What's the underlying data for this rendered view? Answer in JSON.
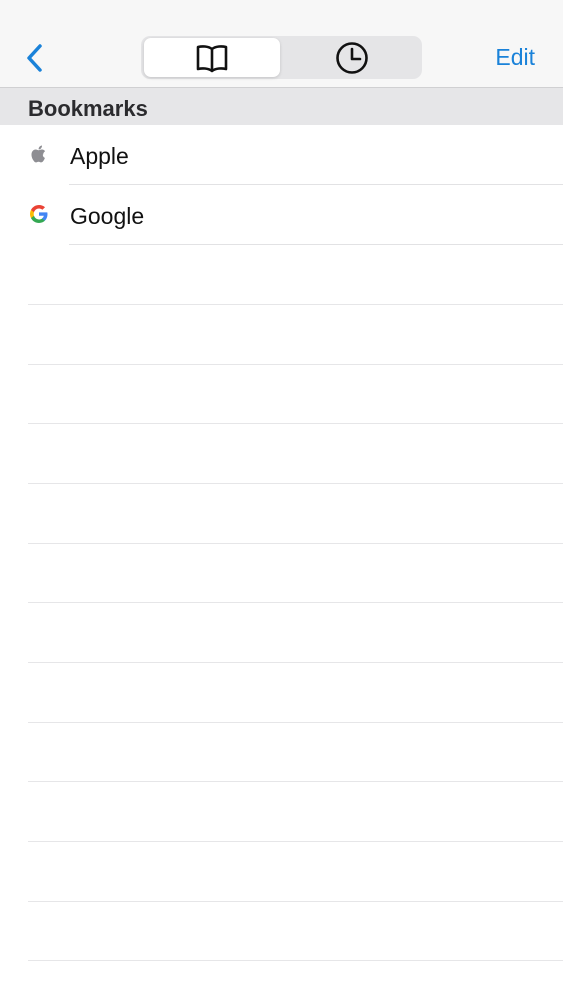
{
  "navbar": {
    "back_icon": "chevron-left-icon",
    "segments": [
      {
        "icon": "book-icon",
        "selected": true
      },
      {
        "icon": "clock-icon",
        "selected": false
      }
    ],
    "edit_label": "Edit"
  },
  "section": {
    "title": "Bookmarks"
  },
  "bookmarks": [
    {
      "label": "Apple",
      "icon": "apple-icon"
    },
    {
      "label": "Google",
      "icon": "google-icon"
    }
  ],
  "colors": {
    "accent": "#1a82d9",
    "navbar_bg": "#f7f7f7",
    "header_bg": "#e6e6e8",
    "separator": "#e2e2e4"
  }
}
